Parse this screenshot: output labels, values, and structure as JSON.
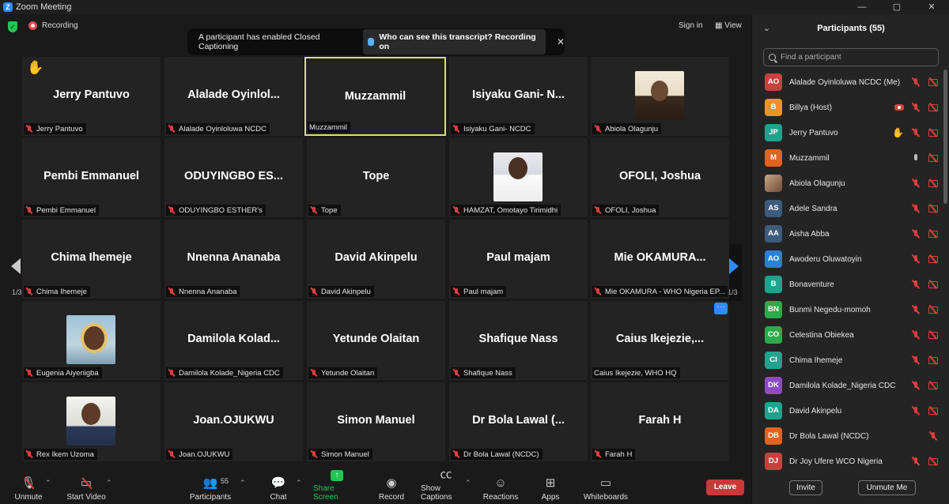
{
  "window": {
    "title": "Zoom Meeting",
    "controls": [
      "—",
      "▢",
      "✕"
    ]
  },
  "topbar": {
    "recording_label": "Recording",
    "sign_in": "Sign in",
    "view": "View"
  },
  "banner": {
    "message": "A participant has enabled Closed Captioning",
    "who_label": "Who can see this transcript? Recording on",
    "close": "✕"
  },
  "grid": {
    "page_prev": "1/3",
    "page_next": "1/3",
    "tiles": [
      {
        "big": "Jerry Pantuvo",
        "label": "Jerry Pantuvo"
      },
      {
        "big": "Alalade  Oyinlol...",
        "label": "Alalade Oyinloluwa NCDC"
      },
      {
        "big": "Muzzammil",
        "label": "Muzzammil"
      },
      {
        "big": "Isiyaku Gani- N...",
        "label": "Isiyaku Gani- NCDC"
      },
      {
        "big": "",
        "label": "Abiola Olagunju"
      },
      {
        "big": "Pembi Emmanuel",
        "label": "Pembi Emmanuel"
      },
      {
        "big": "ODUYINGBO  ES...",
        "label": "ODUYINGBO ESTHER's"
      },
      {
        "big": "Tope",
        "label": "Tope"
      },
      {
        "big": "",
        "label": "HAMZAT, Omotayo Tirimidhi"
      },
      {
        "big": "OFOLI, Joshua",
        "label": "OFOLI, Joshua"
      },
      {
        "big": "Chima Ihemeje",
        "label": "Chima Ihemeje"
      },
      {
        "big": "Nnenna Ananaba",
        "label": "Nnenna Ananaba"
      },
      {
        "big": "David Akinpelu",
        "label": "David Akinpelu"
      },
      {
        "big": "Paul majam",
        "label": "Paul majam"
      },
      {
        "big": "Mie  OKAMURA...",
        "label": "Mie OKAMURA - WHO Nigeria EP..."
      },
      {
        "big": "",
        "label": "Eugenia Aiyenigba"
      },
      {
        "big": "Damilola  Kolad...",
        "label": "Damilola Kolade_Nigeria CDC"
      },
      {
        "big": "Yetunde Olaitan",
        "label": "Yetunde Olaitan"
      },
      {
        "big": "Shafique Nass",
        "label": "Shafique Nass"
      },
      {
        "big": "Caius  Ikejezie,...",
        "label": "Caius Ikejezie, WHO HQ"
      },
      {
        "big": "",
        "label": "Rex Ikem Uzoma"
      },
      {
        "big": "Joan.OJUKWU",
        "label": "Joan.OJUKWU"
      },
      {
        "big": "Simon Manuel",
        "label": "Simon Manuel"
      },
      {
        "big": "Dr Bola  Lawal (...",
        "label": "Dr Bola Lawal (NCDC)"
      },
      {
        "big": "Farah H",
        "label": "Farah H"
      }
    ]
  },
  "toolbar": {
    "unmute": "Unmute",
    "start_video": "Start Video",
    "participants": "Participants",
    "participants_count": "55",
    "chat": "Chat",
    "share_screen": "Share Screen",
    "record": "Record",
    "show_captions": "Show Captions",
    "reactions": "Reactions",
    "apps": "Apps",
    "whiteboards": "Whiteboards",
    "leave": "Leave",
    "share_color": "#23c552",
    "leave_color": "#c93939"
  },
  "panel": {
    "title": "Participants (55)",
    "search_placeholder": "Find a participant",
    "invite": "Invite",
    "unmute_me": "Unmute Me",
    "participants": [
      {
        "initials": "AO",
        "name": "Alalade Oyinloluwa NCDC (Me)",
        "color": "#c8413d"
      },
      {
        "initials": "B",
        "name": "Billya (Host)",
        "color": "#e9951f"
      },
      {
        "initials": "JP",
        "name": "Jerry Pantuvo",
        "color": "#1fa38e"
      },
      {
        "initials": "M",
        "name": "Muzzammil",
        "color": "#e0641e"
      },
      {
        "initials": "",
        "name": "Abiola Olagunju",
        "color": "#a07a60"
      },
      {
        "initials": "AS",
        "name": "Adele Sandra",
        "color": "#3d5b7a"
      },
      {
        "initials": "AA",
        "name": "Aisha Abba",
        "color": "#3d5b7a"
      },
      {
        "initials": "AO",
        "name": "Awoderu Oluwatoyin",
        "color": "#2d7fd6"
      },
      {
        "initials": "B",
        "name": "Bonaventure",
        "color": "#1fa38e"
      },
      {
        "initials": "BN",
        "name": "Bunmi Negedu-momoh",
        "color": "#2eaa4a"
      },
      {
        "initials": "CO",
        "name": "Celestina Obiekea",
        "color": "#2eaa4a"
      },
      {
        "initials": "CI",
        "name": "Chima Ihemeje",
        "color": "#1fa38e"
      },
      {
        "initials": "DK",
        "name": "Damilola Kolade_Nigeria CDC",
        "color": "#8e4bbf"
      },
      {
        "initials": "DA",
        "name": "David Akinpelu",
        "color": "#1fa38e"
      },
      {
        "initials": "DB",
        "name": "Dr Bola Lawal (NCDC)",
        "color": "#e0641e"
      },
      {
        "initials": "DJ",
        "name": "Dr Joy Ufere WCO Nigeria",
        "color": "#c8413d"
      }
    ]
  }
}
